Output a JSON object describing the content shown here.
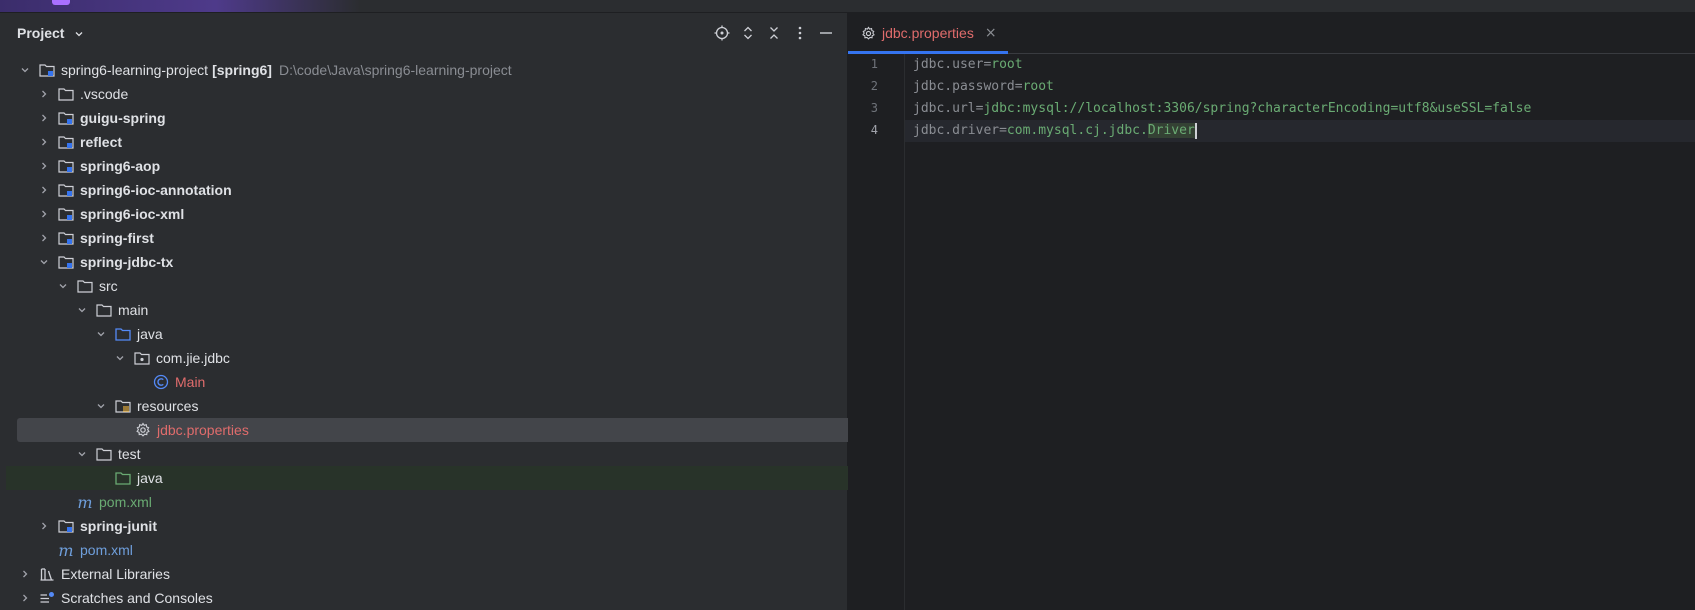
{
  "panel": {
    "title": "Project"
  },
  "tree": {
    "root": {
      "name": "spring6-learning-project",
      "tag": "[spring6]",
      "path": "D:\\code\\Java\\spring6-learning-project"
    },
    "vscode": ".vscode",
    "guigu": "guigu-spring",
    "reflect": "reflect",
    "aop": "spring6-aop",
    "ioc_annotation": "spring6-ioc-annotation",
    "ioc_xml": "spring6-ioc-xml",
    "first": "spring-first",
    "jdbc_tx": "spring-jdbc-tx",
    "src": "src",
    "main": "main",
    "java_main": "java",
    "package": "com.jie.jdbc",
    "main_class": "Main",
    "resources": "resources",
    "jdbc_props": "jdbc.properties",
    "test": "test",
    "java_test": "java",
    "pom_module": "pom.xml",
    "junit": "spring-junit",
    "pom_root": "pom.xml",
    "ext_libs": "External Libraries",
    "scratches": "Scratches and Consoles"
  },
  "editor": {
    "tab_name": "jdbc.properties",
    "tab_close": "×",
    "lines": [
      {
        "num": "1",
        "key": "jdbc.user=",
        "value": "root"
      },
      {
        "num": "2",
        "key": "jdbc.password=",
        "value": "root"
      },
      {
        "num": "3",
        "key": "jdbc.url=",
        "value": "jdbc:mysql://localhost:3306/spring?characterEncoding=utf8&useSSL=false"
      },
      {
        "num": "4",
        "key": "jdbc.driver=",
        "value_a": "com.mysql.cj.jdbc.",
        "value_b": "Driver"
      }
    ]
  },
  "colors": {
    "accent": "#3574f0",
    "error_text": "#e06c6c",
    "value_text": "#6aab73"
  }
}
